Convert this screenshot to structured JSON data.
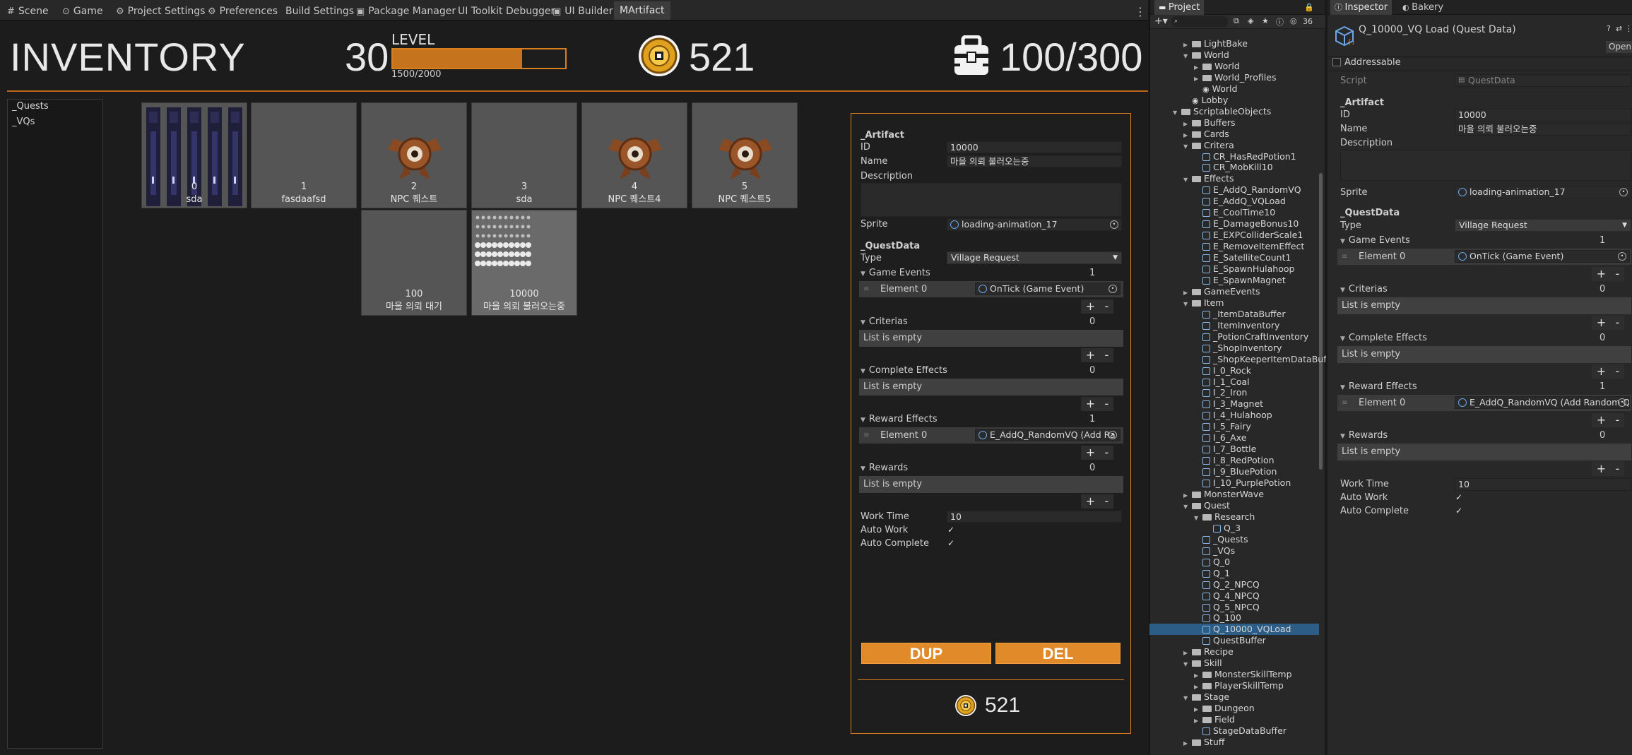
{
  "tabs": [
    {
      "label": "Scene",
      "icon": "scene-icon"
    },
    {
      "label": "Game",
      "icon": "gamepad-icon"
    },
    {
      "label": "Project Settings",
      "icon": "gear-icon"
    },
    {
      "label": "Preferences",
      "icon": "gear-icon"
    },
    {
      "label": "Build Settings",
      "icon": ""
    },
    {
      "label": "Package Manager",
      "icon": "package-icon"
    },
    {
      "label": "UI Toolkit Debugger",
      "icon": ""
    },
    {
      "label": "UI Builder",
      "icon": "builder-icon"
    },
    {
      "label": "MArtifact",
      "icon": ""
    }
  ],
  "hud": {
    "title": "INVENTORY",
    "level": "30",
    "level_label": "LEVEL",
    "level_progress": 0.75,
    "level_text": "1500/2000",
    "coins": "521",
    "capacity": "100/300"
  },
  "categories": [
    "_Quests",
    "_VQs"
  ],
  "cards": [
    {
      "num": "0",
      "name": "sda",
      "art": "sprite-sheet"
    },
    {
      "num": "1",
      "name": "fasdaafsd",
      "art": "none"
    },
    {
      "num": "2",
      "name": "NPC 퀘스트",
      "art": "npc"
    },
    {
      "num": "3",
      "name": "sda",
      "art": "none"
    },
    {
      "num": "4",
      "name": "NPC 퀘스트4",
      "art": "npc"
    },
    {
      "num": "5",
      "name": "NPC 퀘스트5",
      "art": "npc"
    },
    {
      "num": "100",
      "name": "마을 의뢰 대기",
      "art": "none"
    },
    {
      "num": "10000",
      "name": "마을 의뢰 불러오는중",
      "art": "loading"
    }
  ],
  "detail": {
    "artifact_header": "_Artifact",
    "id_label": "ID",
    "id_value": "10000",
    "name_label": "Name",
    "name_value": "마을 의뢰 불러오는중",
    "desc_label": "Description",
    "sprite_label": "Sprite",
    "sprite_value": "loading-animation_17",
    "quest_header": "_QuestData",
    "type_label": "Type",
    "type_value": "Village Request",
    "game_events_label": "Game Events",
    "game_events_count": "1",
    "element0_label": "Element 0",
    "game_event_value": "OnTick (Game Event)",
    "criterias_label": "Criterias",
    "criterias_count": "0",
    "list_empty": "List is empty",
    "complete_label": "Complete Effects",
    "complete_count": "0",
    "reward_effects_label": "Reward Effects",
    "reward_effects_count": "1",
    "reward_effect_value": "E_AddQ_RandomVQ (Add Ra",
    "rewards_label": "Rewards",
    "rewards_count": "0",
    "work_time_label": "Work Time",
    "work_time_value": "10",
    "auto_work_label": "Auto Work",
    "auto_complete_label": "Auto Complete",
    "check": "✓",
    "plus": "+",
    "minus": "-",
    "dup_label": "DUP",
    "del_label": "DEL",
    "footer_coins": "521"
  },
  "project": {
    "tab_label": "Project",
    "count": "36",
    "tree": [
      {
        "t": "LightBake",
        "d": 1,
        "k": "folder",
        "a": "▶"
      },
      {
        "t": "World",
        "d": 1,
        "k": "folder",
        "a": "▼"
      },
      {
        "t": "World",
        "d": 2,
        "k": "folder",
        "a": "▶"
      },
      {
        "t": "World_Profiles",
        "d": 2,
        "k": "folder",
        "a": "▶"
      },
      {
        "t": "World",
        "d": 2,
        "k": "scene",
        "a": ""
      },
      {
        "t": "Lobby",
        "d": 1,
        "k": "scene",
        "a": ""
      },
      {
        "t": "ScriptableObjects",
        "d": 0,
        "k": "folder",
        "a": "▼"
      },
      {
        "t": "Buffers",
        "d": 1,
        "k": "folder",
        "a": "▶"
      },
      {
        "t": "Cards",
        "d": 1,
        "k": "folder",
        "a": "▶"
      },
      {
        "t": "Critera",
        "d": 1,
        "k": "folder",
        "a": "▼"
      },
      {
        "t": "CR_HasRedPotion1",
        "d": 2,
        "k": "so",
        "a": ""
      },
      {
        "t": "CR_MobKill10",
        "d": 2,
        "k": "so",
        "a": ""
      },
      {
        "t": "Effects",
        "d": 1,
        "k": "folder",
        "a": "▼"
      },
      {
        "t": "E_AddQ_RandomVQ",
        "d": 2,
        "k": "so",
        "a": ""
      },
      {
        "t": "E_AddQ_VQLoad",
        "d": 2,
        "k": "so",
        "a": ""
      },
      {
        "t": "E_CoolTime10",
        "d": 2,
        "k": "so",
        "a": ""
      },
      {
        "t": "E_DamageBonus10",
        "d": 2,
        "k": "so",
        "a": ""
      },
      {
        "t": "E_EXPColliderScale1",
        "d": 2,
        "k": "so",
        "a": ""
      },
      {
        "t": "E_RemoveItemEffect",
        "d": 2,
        "k": "so",
        "a": ""
      },
      {
        "t": "E_SatelliteCount1",
        "d": 2,
        "k": "so",
        "a": ""
      },
      {
        "t": "E_SpawnHulahoop",
        "d": 2,
        "k": "so",
        "a": ""
      },
      {
        "t": "E_SpawnMagnet",
        "d": 2,
        "k": "so",
        "a": ""
      },
      {
        "t": "GameEvents",
        "d": 1,
        "k": "folder",
        "a": "▶"
      },
      {
        "t": "Item",
        "d": 1,
        "k": "folder",
        "a": "▼"
      },
      {
        "t": "_ItemDataBuffer",
        "d": 2,
        "k": "so",
        "a": ""
      },
      {
        "t": "_ItemInventory",
        "d": 2,
        "k": "so",
        "a": ""
      },
      {
        "t": "_PotionCraftInventory",
        "d": 2,
        "k": "so",
        "a": ""
      },
      {
        "t": "_ShopInventory",
        "d": 2,
        "k": "so",
        "a": ""
      },
      {
        "t": "_ShopKeeperItemDataBuff",
        "d": 2,
        "k": "so",
        "a": ""
      },
      {
        "t": "I_0_Rock",
        "d": 2,
        "k": "so",
        "a": ""
      },
      {
        "t": "I_1_Coal",
        "d": 2,
        "k": "so",
        "a": ""
      },
      {
        "t": "I_2_Iron",
        "d": 2,
        "k": "so",
        "a": ""
      },
      {
        "t": "I_3_Magnet",
        "d": 2,
        "k": "so",
        "a": ""
      },
      {
        "t": "I_4_Hulahoop",
        "d": 2,
        "k": "so",
        "a": ""
      },
      {
        "t": "I_5_Fairy",
        "d": 2,
        "k": "so",
        "a": ""
      },
      {
        "t": "I_6_Axe",
        "d": 2,
        "k": "so",
        "a": ""
      },
      {
        "t": "I_7_Bottle",
        "d": 2,
        "k": "so",
        "a": ""
      },
      {
        "t": "I_8_RedPotion",
        "d": 2,
        "k": "so",
        "a": ""
      },
      {
        "t": "I_9_BluePotion",
        "d": 2,
        "k": "so",
        "a": ""
      },
      {
        "t": "I_10_PurplePotion",
        "d": 2,
        "k": "so",
        "a": ""
      },
      {
        "t": "MonsterWave",
        "d": 1,
        "k": "folder",
        "a": "▶"
      },
      {
        "t": "Quest",
        "d": 1,
        "k": "folder",
        "a": "▼"
      },
      {
        "t": "Research",
        "d": 2,
        "k": "folder",
        "a": "▼"
      },
      {
        "t": "Q_3",
        "d": 3,
        "k": "so",
        "a": ""
      },
      {
        "t": "_Quests",
        "d": 2,
        "k": "so",
        "a": ""
      },
      {
        "t": "_VQs",
        "d": 2,
        "k": "so",
        "a": ""
      },
      {
        "t": "Q_0",
        "d": 2,
        "k": "so",
        "a": ""
      },
      {
        "t": "Q_1",
        "d": 2,
        "k": "so",
        "a": ""
      },
      {
        "t": "Q_2_NPCQ",
        "d": 2,
        "k": "so",
        "a": ""
      },
      {
        "t": "Q_4_NPCQ",
        "d": 2,
        "k": "so",
        "a": ""
      },
      {
        "t": "Q_5_NPCQ",
        "d": 2,
        "k": "so",
        "a": ""
      },
      {
        "t": "Q_100",
        "d": 2,
        "k": "so",
        "a": ""
      },
      {
        "t": "Q_10000_VQLoad",
        "d": 2,
        "k": "so",
        "a": "",
        "sel": true
      },
      {
        "t": "QuestBuffer",
        "d": 2,
        "k": "so",
        "a": ""
      },
      {
        "t": "Recipe",
        "d": 1,
        "k": "folder",
        "a": "▶"
      },
      {
        "t": "Skill",
        "d": 1,
        "k": "folder",
        "a": "▼"
      },
      {
        "t": "MonsterSkillTemp",
        "d": 2,
        "k": "folder",
        "a": "▶"
      },
      {
        "t": "PlayerSkillTemp",
        "d": 2,
        "k": "folder",
        "a": "▶"
      },
      {
        "t": "Stage",
        "d": 1,
        "k": "folder",
        "a": "▼"
      },
      {
        "t": "Dungeon",
        "d": 2,
        "k": "folder",
        "a": "▶"
      },
      {
        "t": "Field",
        "d": 2,
        "k": "folder",
        "a": "▶"
      },
      {
        "t": "StageDataBuffer",
        "d": 2,
        "k": "so",
        "a": ""
      },
      {
        "t": "Stuff",
        "d": 1,
        "k": "folder",
        "a": "▶"
      }
    ]
  },
  "inspector": {
    "tab_label": "Inspector",
    "tab2_label": "Bakery",
    "asset_title": "Q_10000_VQ Load (Quest Data)",
    "open_label": "Open",
    "addressable_label": "Addressable",
    "script_label": "Script",
    "script_value": "QuestData",
    "artifact_header": "_Artifact",
    "id_label": "ID",
    "id_value": "10000",
    "name_label": "Name",
    "name_value": "마을 의뢰 불러오는중",
    "desc_label": "Description",
    "sprite_label": "Sprite",
    "sprite_value": "loading-animation_17",
    "quest_header": "_QuestData",
    "type_label": "Type",
    "type_value": "Village Request",
    "game_events_label": "Game Events",
    "game_events_count": "1",
    "element0_label": "Element 0",
    "game_event_value": "OnTick (Game Event)",
    "criterias_label": "Criterias",
    "criterias_count": "0",
    "list_empty": "List is empty",
    "complete_label": "Complete Effects",
    "complete_count": "0",
    "reward_effects_label": "Reward Effects",
    "reward_effects_count": "1",
    "reward_effect_value": "E_AddQ_RandomVQ (Add Random Qu",
    "rewards_label": "Rewards",
    "rewards_count": "0",
    "work_time_label": "Work Time",
    "work_time_value": "10",
    "auto_work_label": "Auto Work",
    "auto_complete_label": "Auto Complete",
    "check": "✓",
    "plus": "+",
    "minus": "-"
  },
  "colors": {
    "accent": "#d97f1f",
    "button": "#e08a2a",
    "selection": "#2c5d87"
  }
}
